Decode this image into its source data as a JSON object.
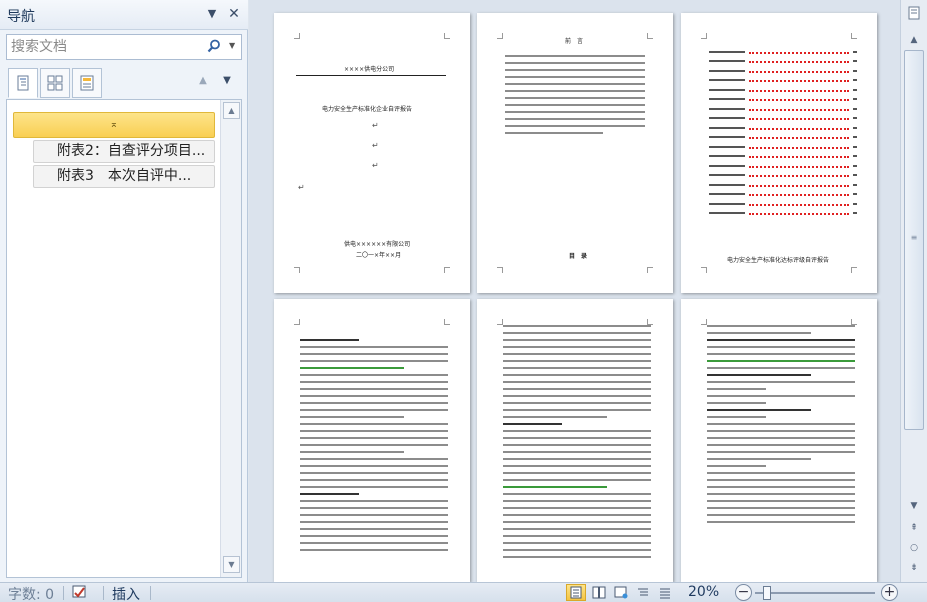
{
  "nav": {
    "title": "导航",
    "search_placeholder": "搜索文档",
    "headings": {
      "selected_label": "⌅",
      "items": [
        {
          "label": "附表2：自查评分项目..."
        },
        {
          "label": "附表3　本次自评中..."
        }
      ]
    }
  },
  "pages": {
    "p1": {
      "company": "××××供电分公司",
      "title": "电力安全生产标准化企业自评报告",
      "signature": "供电××××××有限公司",
      "date": "二〇一×年××月"
    },
    "p2": {
      "heading": "前　言",
      "toc_heading": "目　录"
    },
    "p3": {
      "footer_title": "电力安全生产标准化达标评级自评报告"
    }
  },
  "statusbar": {
    "word_count": "字数: 0",
    "insert_mode": "插入",
    "zoom": "20%"
  }
}
